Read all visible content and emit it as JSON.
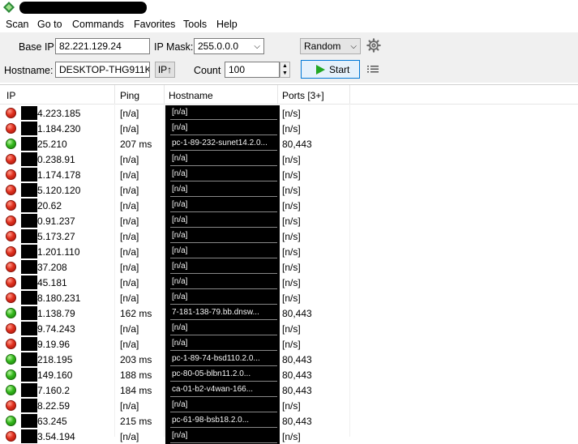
{
  "window": {
    "title_redacted": true
  },
  "menu": [
    "Scan",
    "Go to",
    "Commands",
    "Favorites",
    "Tools",
    "Help"
  ],
  "toolbar": {
    "base_ip_label": "Base IP:",
    "base_ip_value": "82.221.129.24",
    "ip_mask_label": "IP Mask:",
    "ip_mask_value": "255.0.0.0",
    "mode_value": "Random",
    "hostname_label": "Hostname:",
    "hostname_value": "DESKTOP-THG911K",
    "ip_up_label": "IP↑",
    "count_label": "Count",
    "count_value": "100",
    "start_label": "Start",
    "icons": {
      "settings": "gear-icon",
      "columns": "list-icon",
      "start": "play-icon"
    }
  },
  "table": {
    "columns": [
      "IP",
      "Ping",
      "Hostname",
      "Ports [3+]"
    ],
    "rows": [
      {
        "ip": "4.223.185",
        "ping": "[n/a]",
        "hostname": "[n/a]",
        "ports": "[n/s]",
        "status": "dead"
      },
      {
        "ip": "1.184.230",
        "ping": "[n/a]",
        "hostname": "[n/a]",
        "ports": "[n/s]",
        "status": "dead"
      },
      {
        "ip": "25.210",
        "ping": "207 ms",
        "hostname": "pc-1-89-232-sunet14.2.0...",
        "ports": "80,443",
        "status": "alive"
      },
      {
        "ip": "0.238.91",
        "ping": "[n/a]",
        "hostname": "[n/a]",
        "ports": "[n/s]",
        "status": "dead"
      },
      {
        "ip": "1.174.178",
        "ping": "[n/a]",
        "hostname": "[n/a]",
        "ports": "[n/s]",
        "status": "dead"
      },
      {
        "ip": "5.120.120",
        "ping": "[n/a]",
        "hostname": "[n/a]",
        "ports": "[n/s]",
        "status": "dead"
      },
      {
        "ip": "20.62",
        "ping": "[n/a]",
        "hostname": "[n/a]",
        "ports": "[n/s]",
        "status": "dead"
      },
      {
        "ip": "0.91.237",
        "ping": "[n/a]",
        "hostname": "[n/a]",
        "ports": "[n/s]",
        "status": "dead"
      },
      {
        "ip": "5.173.27",
        "ping": "[n/a]",
        "hostname": "[n/a]",
        "ports": "[n/s]",
        "status": "dead"
      },
      {
        "ip": "1.201.110",
        "ping": "[n/a]",
        "hostname": "[n/a]",
        "ports": "[n/s]",
        "status": "dead"
      },
      {
        "ip": "37.208",
        "ping": "[n/a]",
        "hostname": "[n/a]",
        "ports": "[n/s]",
        "status": "dead"
      },
      {
        "ip": "45.181",
        "ping": "[n/a]",
        "hostname": "[n/a]",
        "ports": "[n/s]",
        "status": "dead"
      },
      {
        "ip": "8.180.231",
        "ping": "[n/a]",
        "hostname": "[n/a]",
        "ports": "[n/s]",
        "status": "dead"
      },
      {
        "ip": "1.138.79",
        "ping": "162 ms",
        "hostname": "7-181-138-79.bb.dnsw...",
        "ports": "80,443",
        "status": "alive"
      },
      {
        "ip": "9.74.243",
        "ping": "[n/a]",
        "hostname": "[n/a]",
        "ports": "[n/s]",
        "status": "dead"
      },
      {
        "ip": "9.19.96",
        "ping": "[n/a]",
        "hostname": "[n/a]",
        "ports": "[n/s]",
        "status": "dead"
      },
      {
        "ip": "218.195",
        "ping": "203 ms",
        "hostname": "pc-1-89-74-bsd110.2.0...",
        "ports": "80,443",
        "status": "alive"
      },
      {
        "ip": "149.160",
        "ping": "188 ms",
        "hostname": "pc-80-05-blbn11.2.0...",
        "ports": "80,443",
        "status": "alive"
      },
      {
        "ip": "7.160.2",
        "ping": "184 ms",
        "hostname": "ca-01-b2-v4wan-166...",
        "ports": "80,443",
        "status": "alive"
      },
      {
        "ip": "8.22.59",
        "ping": "[n/a]",
        "hostname": "[n/a]",
        "ports": "[n/s]",
        "status": "dead"
      },
      {
        "ip": "63.245",
        "ping": "215 ms",
        "hostname": "pc-61-98-bsb18.2.0...",
        "ports": "80,443",
        "status": "alive"
      },
      {
        "ip": "3.54.194",
        "ping": "[n/a]",
        "hostname": "[n/a]",
        "ports": "[n/s]",
        "status": "dead"
      }
    ]
  }
}
